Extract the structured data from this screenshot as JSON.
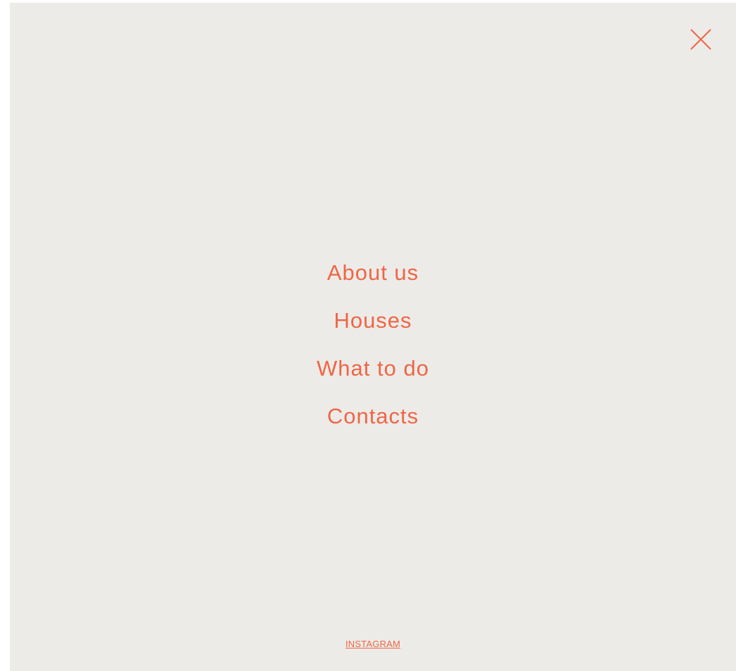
{
  "menu": {
    "close_icon": "close-icon",
    "items": [
      {
        "label": "About us"
      },
      {
        "label": "Houses"
      },
      {
        "label": "What to do"
      },
      {
        "label": "Contacts"
      }
    ]
  },
  "footer": {
    "instagram_label": "INSTAGRAM"
  },
  "colors": {
    "background": "#edebe7",
    "accent": "#ee6647"
  }
}
